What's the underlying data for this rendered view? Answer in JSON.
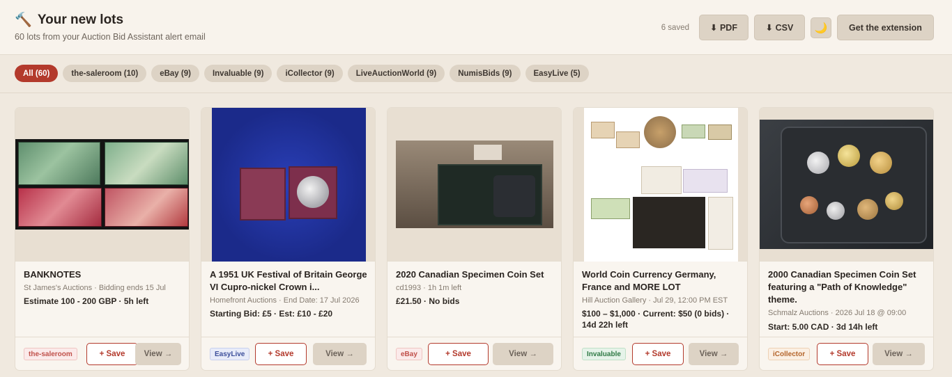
{
  "header": {
    "hammer_icon": "🔨",
    "title": "Your new lots",
    "subtitle": "60 lots from your Auction Bid Assistant alert email",
    "saved_count": "6 saved",
    "pdf_label": "⬇ PDF",
    "csv_label": "⬇ CSV",
    "moon_icon": "🌙",
    "extension_label": "Get the extension"
  },
  "filters": [
    "All (60)",
    "the-saleroom (10)",
    "eBay (9)",
    "Invaluable (9)",
    "iCollector (9)",
    "LiveAuctionWorld (9)",
    "NumisBids (9)",
    "EasyLive (5)"
  ],
  "cards": [
    {
      "title": "BANKNOTES",
      "meta": "St James's Auctions · Bidding ends 15 Jul",
      "price": "Estimate 100 - 200 GBP · 5h left",
      "source": "the-saleroom",
      "save_label": "+ Save",
      "view_label": "View →"
    },
    {
      "title": "A 1951 UK Festival of Britain George VI Cupro-nickel Crown i...",
      "meta": "Homefront Auctions · End Date: 17 Jul 2026",
      "price": "Starting Bid: £5 · Est: £10 - £20",
      "source": "EasyLive",
      "save_label": "+ Save",
      "view_label": "View →"
    },
    {
      "title": "2020 Canadian Specimen Coin Set",
      "meta": "cd1993 · 1h 1m left",
      "price": "£21.50 · No bids",
      "source": "eBay",
      "save_label": "+ Save",
      "view_label": "View →"
    },
    {
      "title": "World Coin Currency Germany, France and MORE LOT",
      "meta": "Hill Auction Gallery · Jul 29, 12:00 PM EST",
      "price": "$100 – $1,000 · Current: $50 (0 bids) · 14d 22h left",
      "source": "Invaluable",
      "save_label": "+ Save",
      "view_label": "View →"
    },
    {
      "title": "2000 Canadian Specimen Coin Set featuring a \"Path of Knowledge\" theme.",
      "meta": "Schmalz Auctions · 2026 Jul 18 @ 09:00",
      "price": "Start: 5.00 CAD · 3d 14h left",
      "source": "iCollector",
      "save_label": "+ Save",
      "view_label": "View →"
    }
  ],
  "colors": {
    "accent": "#b33a2c",
    "chip_bg": "#ddd3c5",
    "page_bg": "#f0e9df"
  }
}
